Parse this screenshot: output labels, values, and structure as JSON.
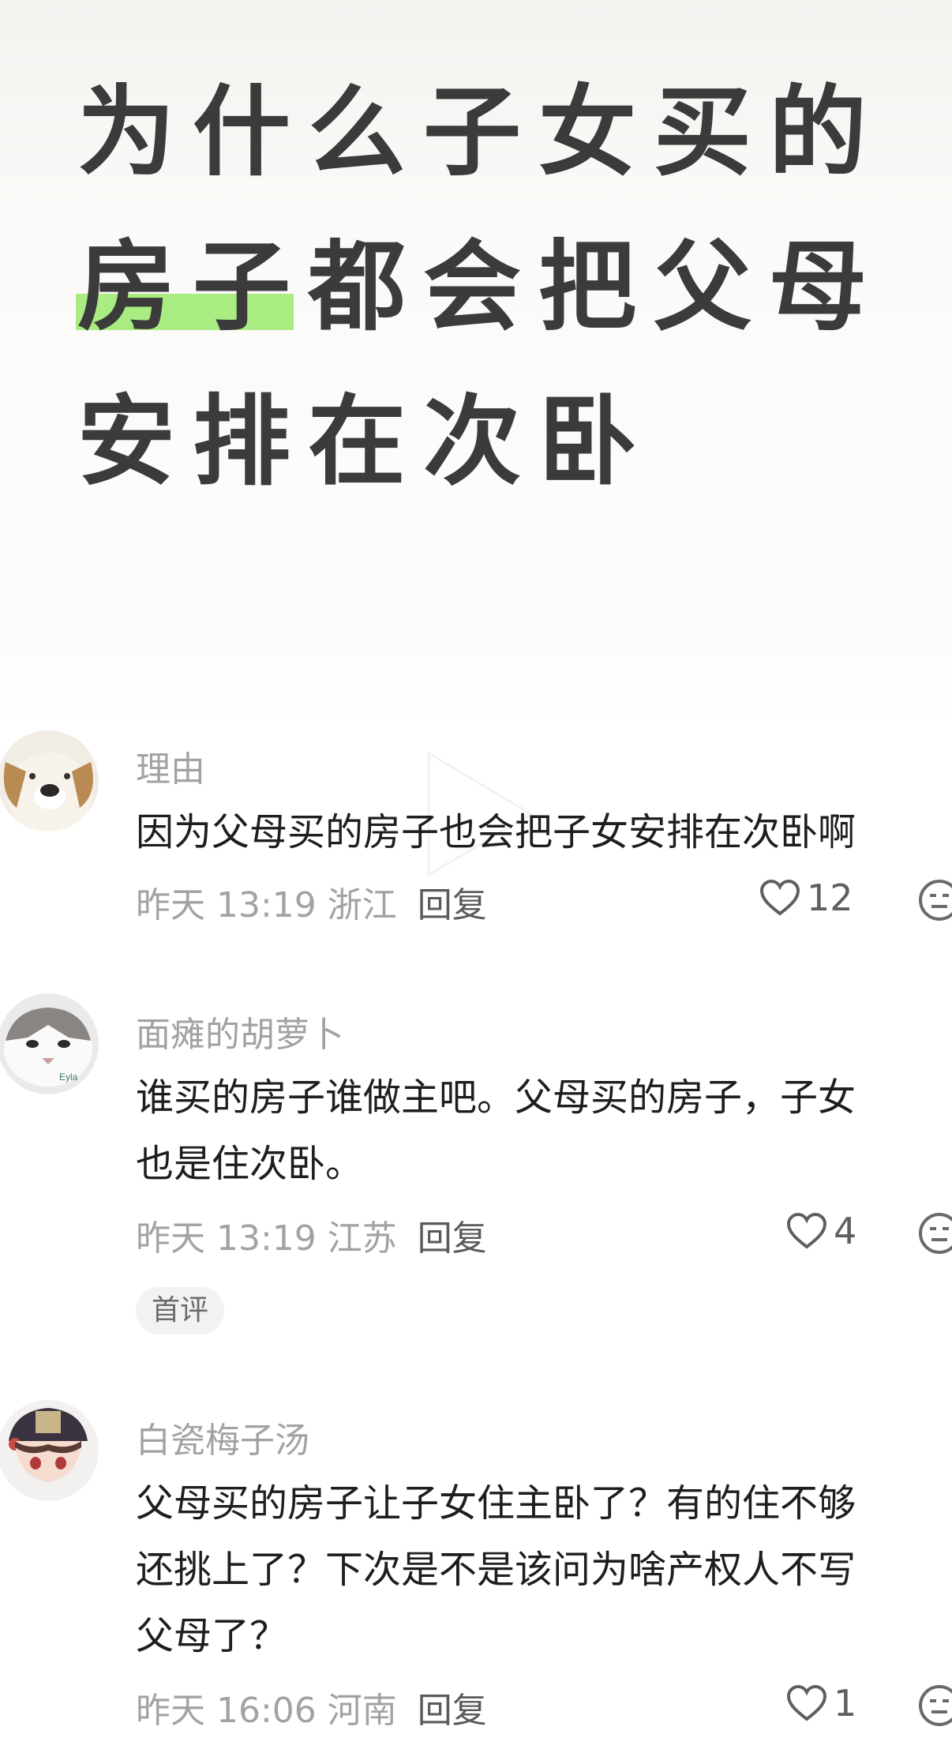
{
  "post": {
    "title_lines": [
      "为什么子女买的",
      "都会把父母",
      "安排在次卧"
    ],
    "title_highlight": "房子",
    "highlight_color": "#a9ec82"
  },
  "comments": [
    {
      "username": "理由",
      "text_lines": [
        "因为父母买的房子也会把子女安排在次卧啊"
      ],
      "time": "昨天 13:19 浙江",
      "reply_label": "回复",
      "likes": "12",
      "avatar_icon": "dog-avatar-icon"
    },
    {
      "username": "面瘫的胡萝卜",
      "text_lines": [
        "谁买的房子谁做主吧。父母买的房子，子女",
        "也是住次卧。"
      ],
      "time": "昨天 13:19 江苏",
      "reply_label": "回复",
      "likes": "4",
      "badge": "首评",
      "avatar_text": "Eyla",
      "avatar_icon": "cat-avatar-icon"
    },
    {
      "username": "白瓷梅子汤",
      "text_lines": [
        "父母买的房子让子女住主卧了？有的住不够",
        "还挑上了？下次是不是该问为啥产权人不写",
        "父母了？"
      ],
      "time": "昨天 16:06 河南",
      "reply_label": "回复",
      "likes": "1",
      "avatar_icon": "anime-girl-avatar-icon"
    }
  ]
}
